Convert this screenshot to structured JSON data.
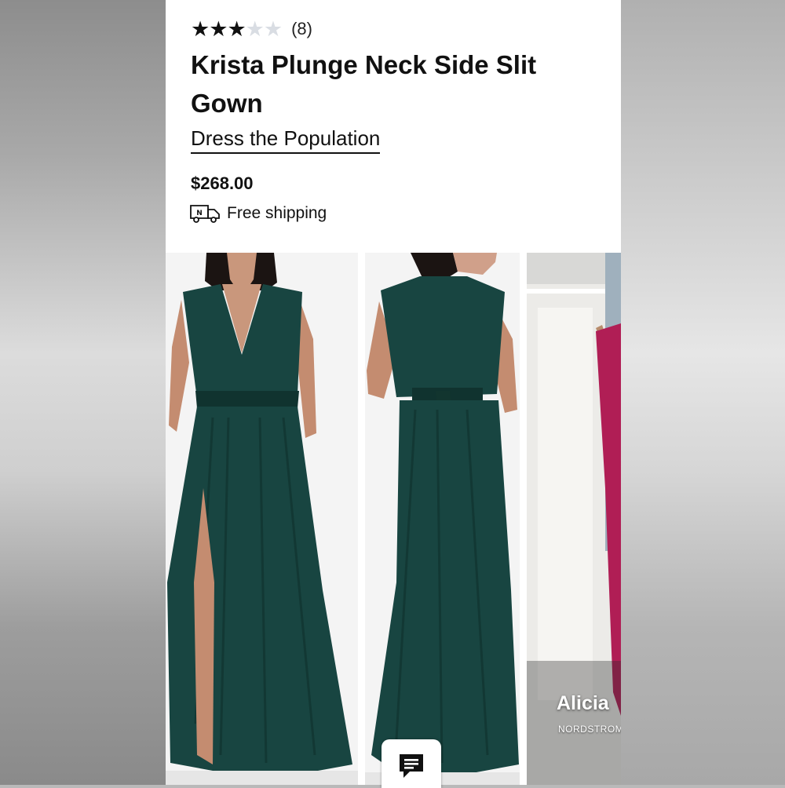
{
  "product": {
    "rating": {
      "value": 3,
      "max": 5,
      "count_label": "(8)"
    },
    "title": "Krista Plunge Neck Side Slit Gown",
    "brand": "Dress the Population",
    "price": "$268.00",
    "shipping": {
      "icon": "truck-icon",
      "label": "Free shipping"
    }
  },
  "gallery": {
    "images": [
      {
        "name": "front-view",
        "color": "#163f3b"
      },
      {
        "name": "back-view",
        "color": "#163f3b"
      },
      {
        "name": "video-preview",
        "color": "#b01e55"
      }
    ],
    "video_overlay": {
      "name": "Alicia",
      "store": "NORDSTROM"
    }
  },
  "chat": {
    "icon": "chat-icon"
  }
}
